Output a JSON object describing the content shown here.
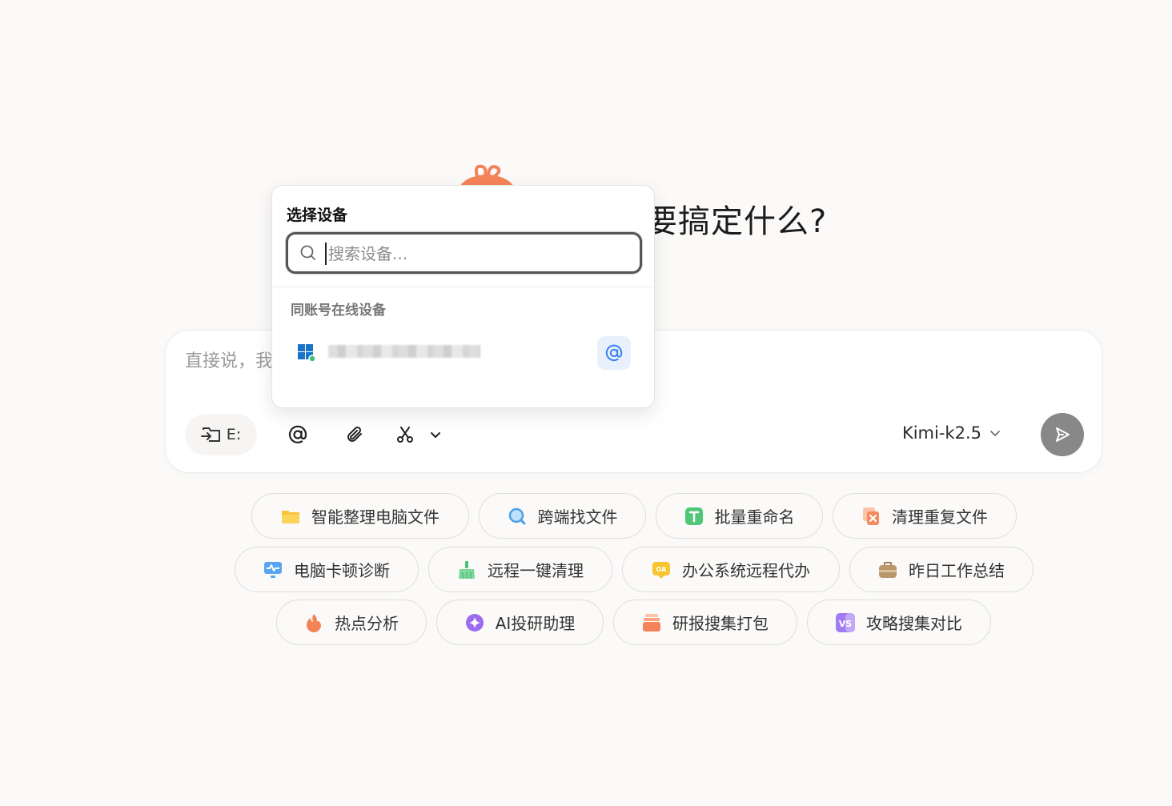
{
  "hero": {
    "title_visible": "要搞定什么?"
  },
  "composer": {
    "placeholder": "直接说，我",
    "folder_label": "E:",
    "model": "Kimi-k2.5"
  },
  "chips": [
    {
      "label": "智能整理电脑文件",
      "icon": "folder-icon"
    },
    {
      "label": "跨端找文件",
      "icon": "search-icon"
    },
    {
      "label": "批量重命名",
      "icon": "text-t-icon"
    },
    {
      "label": "清理重复文件",
      "icon": "duplicate-remove-icon"
    },
    {
      "label": "电脑卡顿诊断",
      "icon": "monitor-pulse-icon"
    },
    {
      "label": "远程一键清理",
      "icon": "broom-icon"
    },
    {
      "label": "办公系统远程代办",
      "icon": "oa-icon"
    },
    {
      "label": "昨日工作总结",
      "icon": "briefcase-icon"
    },
    {
      "label": "热点分析",
      "icon": "fire-icon"
    },
    {
      "label": "AI投研助理",
      "icon": "sparkle-icon"
    },
    {
      "label": "研报搜集打包",
      "icon": "stack-icon"
    },
    {
      "label": "攻略搜集对比",
      "icon": "vs-icon"
    }
  ],
  "device_picker": {
    "title": "选择设备",
    "search_placeholder": "搜索设备...",
    "section_label": "同账号在线设备",
    "devices": [
      {
        "name": "",
        "os_icon": "windows-icon",
        "status": "online"
      }
    ]
  },
  "colors": {
    "background": "#fbfaf9",
    "mascot": "#f5835a",
    "send_button": "#888888",
    "at_accent": "#3b82f6"
  }
}
